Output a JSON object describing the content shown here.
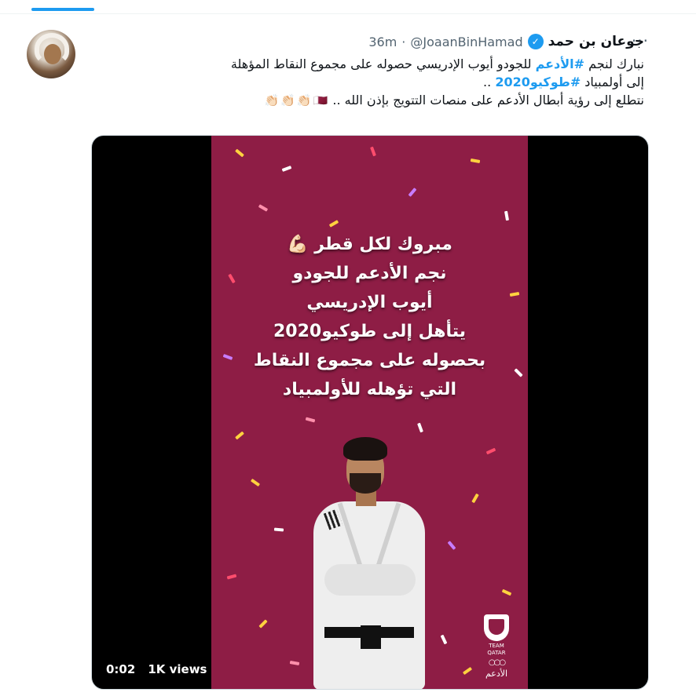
{
  "author": {
    "display_name": "جوعان بن حمد",
    "handle": "@JoaanBinHamad",
    "separator": "·",
    "time": "36m",
    "verified": true
  },
  "tweet": {
    "line1_pre": "نبارك لنجم ",
    "hashtag1": "#الأدعم",
    "line1_post": " للجودو أيوب الإدريسي حصوله على مجموع النقاط المؤهلة",
    "line2_pre": "إلى أولمبياد ",
    "hashtag2": "#طوكيو2020",
    "line2_post": " ..",
    "line3": "نتطلع إلى رؤية أبطال الأدعم على منصات التتويج بإذن الله .."
  },
  "video": {
    "overlay_lines": [
      "مبروك لكل قطر",
      "نجم الأدعم للجودو",
      "أيوب الإدريسي",
      "يتأهل إلى طوكيو2020",
      "بحصوله على مجموع النقاط",
      "التي تؤهله للأولمبياد"
    ],
    "time": "0:02",
    "views": "1K views",
    "logo_label": "TEAM QATAR",
    "logo_caption": "الأدعم"
  },
  "icons": {
    "more": "more-dots-icon",
    "verified": "verified-badge-icon",
    "flag": "qatar-flag-icon",
    "clap": "clapping-hands-icon",
    "muscle": "flexed-biceps-icon"
  },
  "colors": {
    "link": "#1d9bf0",
    "video_bg": "#8e1d45",
    "muted": "#536471"
  }
}
